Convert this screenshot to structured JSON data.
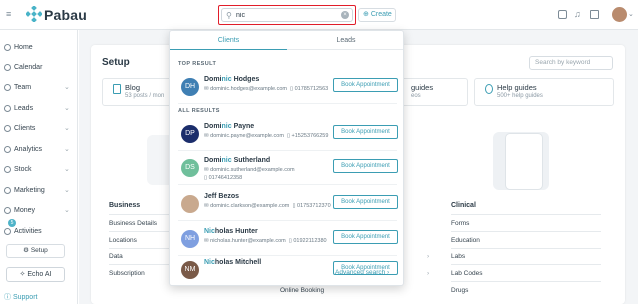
{
  "app": {
    "name": "Pabau"
  },
  "topbar": {
    "search_value": "nic",
    "create_label": "Create"
  },
  "sidebar": {
    "items": [
      {
        "label": "Home",
        "chevron": false
      },
      {
        "label": "Calendar",
        "chevron": false
      },
      {
        "label": "Team",
        "chevron": true
      },
      {
        "label": "Leads",
        "chevron": true
      },
      {
        "label": "Clients",
        "chevron": true
      },
      {
        "label": "Analytics",
        "chevron": true
      },
      {
        "label": "Stock",
        "chevron": true
      },
      {
        "label": "Marketing",
        "chevron": true
      },
      {
        "label": "Money",
        "chevron": true
      },
      {
        "label": "Activities",
        "chevron": false
      }
    ],
    "activities_badge": "5",
    "setup_label": "Setup",
    "echo_label": "Echo AI",
    "support_label": "Support"
  },
  "main": {
    "title": "Setup",
    "keyword_placeholder": "Search by keyword",
    "tiles": [
      {
        "title": "Blog",
        "sub": "53 posts / mon"
      },
      {
        "title": "guides",
        "sub": "eos"
      },
      {
        "title": "Help guides",
        "sub": "500+ help guides"
      }
    ],
    "business": {
      "header": "Business",
      "links": [
        "Business Details",
        "Locations",
        "Data",
        "Subscription"
      ]
    },
    "middle_link": "Online Booking",
    "clinical": {
      "header": "Clinical",
      "links": [
        "Forms",
        "Education",
        "Labs",
        "Lab Codes",
        "Drugs"
      ]
    }
  },
  "dropdown": {
    "tabs": [
      "Clients",
      "Leads"
    ],
    "top_result_label": "TOP RESULT",
    "all_results_label": "ALL RESULTS",
    "book_label": "Book Appointment",
    "advanced_search": "Advanced search",
    "top_result": {
      "initials": "DH",
      "color": "#3f7fb3",
      "name_pre": "Domi",
      "name_hl": "nic",
      "name_post": " Hodges",
      "email": "dominic.hodges@example.com",
      "phone": "01785712563",
      "phone2": ""
    },
    "results": [
      {
        "initials": "DP",
        "color": "#1b2d6b",
        "name_pre": "Domi",
        "name_hl": "nic",
        "name_post": " Payne",
        "email": "dominic.payne@example.com",
        "phone": "+15253766259",
        "phone2": ""
      },
      {
        "initials": "DS",
        "color": "#6fbf9b",
        "name_pre": "Domi",
        "name_hl": "nic",
        "name_post": " Sutherland",
        "email": "dominic.sutherland@example.com",
        "phone": "01746412358",
        "phone2": ""
      },
      {
        "initials": "",
        "color": "#c9a98e",
        "name_pre": "Jeff Bezos",
        "name_hl": "",
        "name_post": "",
        "email": "dominic.clarkson@example.com",
        "phone": "01753712370",
        "phone2": ""
      },
      {
        "initials": "NH",
        "color": "#7f9fe0",
        "name_pre": "",
        "name_hl": "Nic",
        "name_post": "holas Hunter",
        "email": "nicholas.hunter@example.com",
        "phone": "01922112380",
        "phone2": ""
      },
      {
        "initials": "NM",
        "color": "#7a5a48",
        "name_pre": "",
        "name_hl": "Nic",
        "name_post": "holas Mitchell",
        "email": "",
        "phone": "",
        "phone2": ""
      }
    ]
  }
}
